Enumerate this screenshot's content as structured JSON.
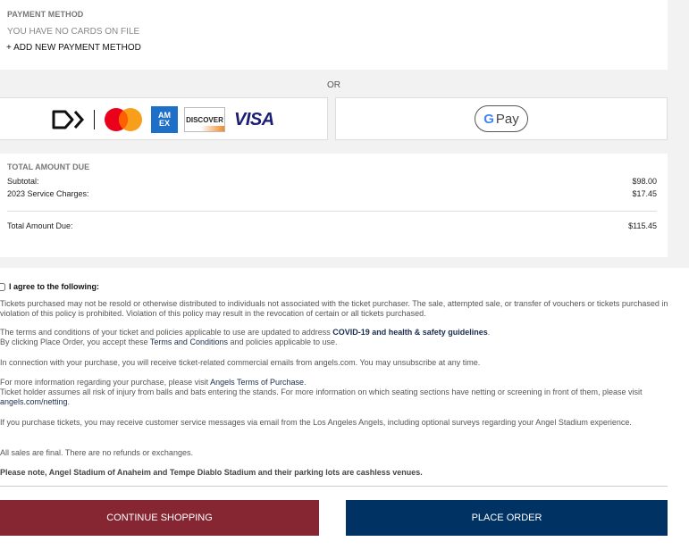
{
  "payment_method": {
    "title": "PAYMENT METHOD",
    "no_cards": "YOU HAVE NO CARDS ON FILE",
    "add_new": "+ ADD NEW PAYMENT METHOD"
  },
  "or_label": "OR",
  "card_logos": {
    "amex_top": "AM",
    "amex_bottom": "EX",
    "discover": "DISCOVER",
    "visa": "VISA"
  },
  "gpay": {
    "g": "G",
    "pay": "Pay"
  },
  "total": {
    "title": "TOTAL AMOUNT DUE",
    "subtotal_label": "Subtotal:",
    "subtotal_value": "$98.00",
    "service_label": "2023 Service Charges:",
    "service_value": "$17.45",
    "total_label": "Total Amount Due:",
    "total_value": "$115.45"
  },
  "terms": {
    "agree_label": "I agree to the following:",
    "p1": "Tickets purchased may not be resold or otherwise distributed to individuals not associated with the ticket purchaser. The sale, attempted sale, or transfer of vouchers or tickets purchased in violation of this policy is prohibited. Violation of this policy may result in the revocation of certain or all tickets purchased.",
    "p2_prefix": "The terms and conditions of your ticket and policies applicable to use are updated to address ",
    "p2_link": "COVID-19 and health & safety guidelines",
    "p2_suffix": ".",
    "p3_prefix": "By clicking Place Order, you accept these ",
    "p3_link": "Terms and Conditions",
    "p3_suffix": " and policies applicable to use.",
    "p4": "In connection with your purchase, you will receive ticket-related commercial emails from angels.com. You may unsubscribe at any time.",
    "p5_prefix": "For more information regarding your purchase, please visit ",
    "p5_link": "Angels Terms of Purchase",
    "p5_suffix": ".",
    "p6_prefix": "Ticket holder assumes all risk of injury from balls and bats entering the stands. For more information on which seating sections have netting or screening in front of them, please visit ",
    "p6_link": "angels.com/netting",
    "p6_suffix": ".",
    "p7": "If you purchase tickets, you may receive customer service messages via email from the Los Angeles Angels, including optional surveys regarding your Angel Stadium experience.",
    "p8": "All sales are final. There are no refunds or exchanges.",
    "p9": "Please note, Angel Stadium of Anaheim and Tempe Diablo Stadium and their parking lots are cashless venues."
  },
  "buttons": {
    "continue": "CONTINUE SHOPPING",
    "place_order": "PLACE ORDER"
  },
  "colors": {
    "continue_bg": "#862633",
    "place_order_bg": "#003263",
    "link": "#1a2b4c"
  }
}
